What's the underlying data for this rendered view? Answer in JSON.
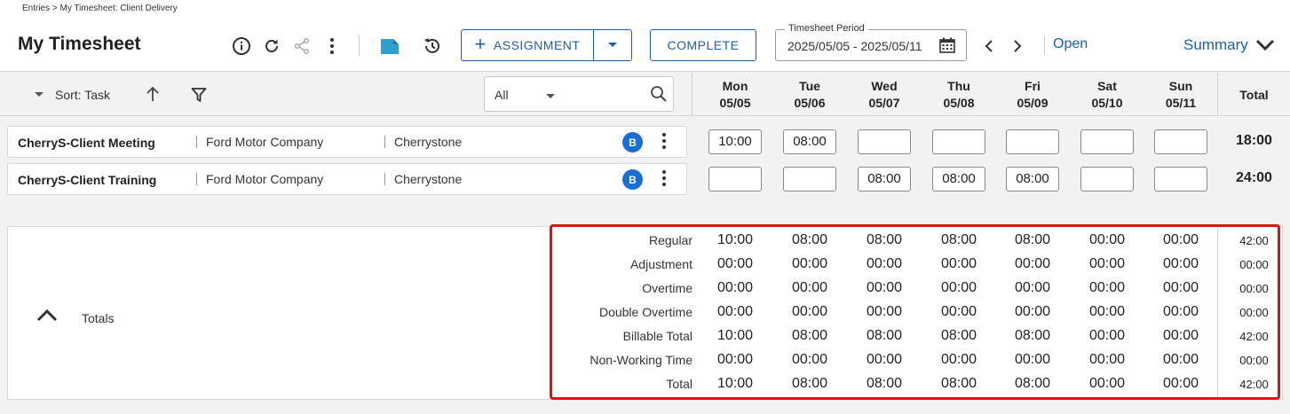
{
  "breadcrumb": "Entries > My Timesheet: Client Delivery",
  "page_title": "My Timesheet",
  "toolbar": {
    "assignment_label": "ASSIGNMENT",
    "complete_label": "COMPLETE",
    "period_label": "Timesheet Period",
    "period_value": "2025/05/05 - 2025/05/11",
    "status_link": "Open",
    "summary_label": "Summary"
  },
  "list_header": {
    "sort_label": "Sort: Task",
    "filter_value": "All",
    "total_label": "Total"
  },
  "days": [
    {
      "dow": "Mon",
      "date": "05/05"
    },
    {
      "dow": "Tue",
      "date": "05/06"
    },
    {
      "dow": "Wed",
      "date": "05/07"
    },
    {
      "dow": "Thu",
      "date": "05/08"
    },
    {
      "dow": "Fri",
      "date": "05/09"
    },
    {
      "dow": "Sat",
      "date": "05/10"
    },
    {
      "dow": "Sun",
      "date": "05/11"
    }
  ],
  "rows": [
    {
      "task": "CherryS-Client Meeting",
      "client": "Ford Motor Company",
      "project": "Cherrystone",
      "badge": "B",
      "hours": [
        "10:00",
        "08:00",
        "",
        "",
        "",
        "",
        ""
      ],
      "total": "18:00"
    },
    {
      "task": "CherryS-Client Training",
      "client": "Ford Motor Company",
      "project": "Cherrystone",
      "badge": "B",
      "hours": [
        "",
        "",
        "08:00",
        "08:00",
        "08:00",
        "",
        ""
      ],
      "total": "24:00"
    }
  ],
  "totals": {
    "label": "Totals",
    "rows": [
      {
        "name": "Regular",
        "values": [
          "10:00",
          "08:00",
          "08:00",
          "08:00",
          "08:00",
          "00:00",
          "00:00"
        ],
        "total": "42:00"
      },
      {
        "name": "Adjustment",
        "values": [
          "00:00",
          "00:00",
          "00:00",
          "00:00",
          "00:00",
          "00:00",
          "00:00"
        ],
        "total": "00:00"
      },
      {
        "name": "Overtime",
        "values": [
          "00:00",
          "00:00",
          "00:00",
          "00:00",
          "00:00",
          "00:00",
          "00:00"
        ],
        "total": "00:00"
      },
      {
        "name": "Double Overtime",
        "values": [
          "00:00",
          "00:00",
          "00:00",
          "00:00",
          "00:00",
          "00:00",
          "00:00"
        ],
        "total": "00:00"
      },
      {
        "name": "Billable Total",
        "values": [
          "10:00",
          "08:00",
          "08:00",
          "08:00",
          "08:00",
          "00:00",
          "00:00"
        ],
        "total": "42:00"
      },
      {
        "name": "Non-Working Time",
        "values": [
          "00:00",
          "00:00",
          "00:00",
          "00:00",
          "00:00",
          "00:00",
          "00:00"
        ],
        "total": "00:00"
      },
      {
        "name": "Total",
        "values": [
          "10:00",
          "08:00",
          "08:00",
          "08:00",
          "08:00",
          "00:00",
          "00:00"
        ],
        "total": "42:00"
      }
    ]
  },
  "colors": {
    "accent": "#1a5fb4",
    "badge": "#1a6ed8",
    "highlight": "#e01010",
    "doc_icon": "#2f9fd0"
  },
  "icons": [
    "info-icon",
    "refresh-icon",
    "share-icon",
    "more-vertical-icon",
    "document-icon",
    "history-icon",
    "plus-icon",
    "chevron-down-icon",
    "calendar-icon",
    "chevron-left-icon",
    "chevron-right-icon",
    "sort-up-icon",
    "filter-icon",
    "search-icon",
    "chevron-up-icon"
  ]
}
